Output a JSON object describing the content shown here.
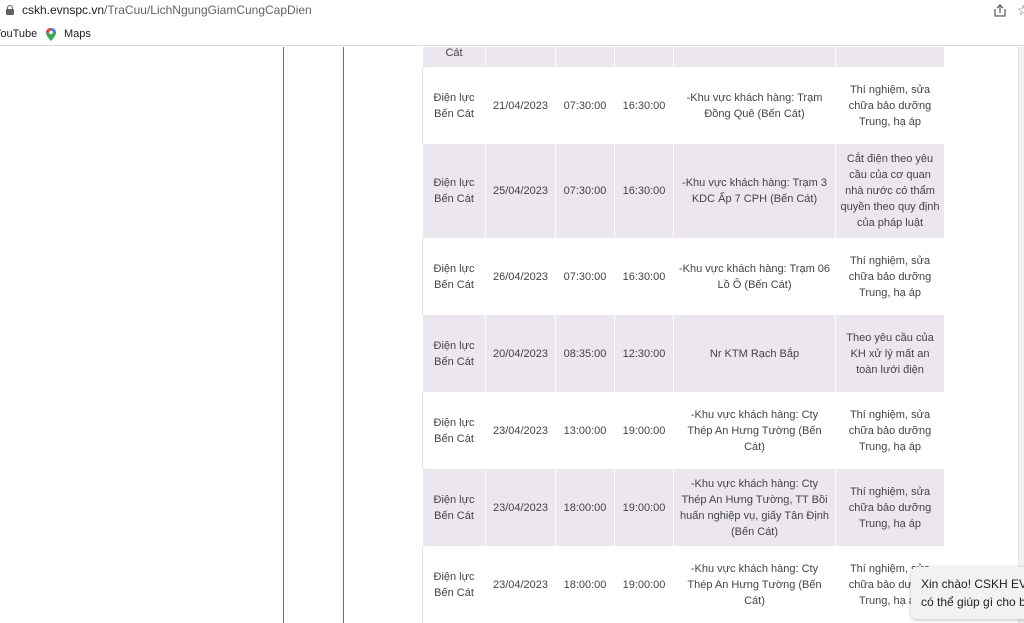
{
  "browser": {
    "url_host": "cskh.evnspc.vn",
    "url_path": "/TraCuu/LichNgungGiamCungCapDien",
    "bookmarks": [
      "YouTube",
      "Maps"
    ]
  },
  "table": {
    "top_partial_cell": "Cát",
    "rows": [
      {
        "unit": "Điện lực Bến Cát",
        "date": "21/04/2023",
        "start": "07:30:00",
        "end": "16:30:00",
        "area": "-Khu vực khách hàng: Trạm Đồng Quê (Bến Cát)",
        "reason": "Thí nghiệm, sửa chữa bảo dưỡng Trung, hạ áp"
      },
      {
        "unit": "Điện lực Bến Cát",
        "date": "25/04/2023",
        "start": "07:30:00",
        "end": "16:30:00",
        "area": "-Khu vực khách hàng: Trạm 3 KDC Ấp 7 CPH (Bến Cát)",
        "reason": "Cắt điện theo yêu cầu của cơ quan nhà nước có thẩm quyền theo quy định của pháp luật"
      },
      {
        "unit": "Điện lực Bến Cát",
        "date": "26/04/2023",
        "start": "07:30:00",
        "end": "16:30:00",
        "area": "-Khu vực khách hàng: Trạm 06 Lồ Ô (Bến Cát)",
        "reason": "Thí nghiệm, sửa chữa bảo dưỡng Trung, hạ áp"
      },
      {
        "unit": "Điện lực Bến Cát",
        "date": "20/04/2023",
        "start": "08:35:00",
        "end": "12:30:00",
        "area": "Nr KTM Rạch Bắp",
        "reason": "Theo yêu cầu của KH xử lý mất an toàn lưới điện"
      },
      {
        "unit": "Điện lực Bến Cát",
        "date": "23/04/2023",
        "start": "13:00:00",
        "end": "19:00:00",
        "area": "-Khu vực khách hàng: Cty Thép An Hưng Tường (Bến Cát)",
        "reason": "Thí nghiệm, sửa chữa bảo dưỡng Trung, hạ áp"
      },
      {
        "unit": "Điện lực Bến Cát",
        "date": "23/04/2023",
        "start": "18:00:00",
        "end": "19:00:00",
        "area": "-Khu vực khách hàng: Cty Thép An Hưng Tường, TT Bồi huấn nghiệp vụ, giấy Tân Định (Bến Cát)",
        "reason": "Thí nghiệm, sửa chữa bảo dưỡng Trung, hạ áp"
      },
      {
        "unit": "Điện lực Bến Cát",
        "date": "23/04/2023",
        "start": "18:00:00",
        "end": "19:00:00",
        "area": "-Khu vực khách hàng: Cty Thép An Hưng Tường (Bến Cát)",
        "reason": "Thí nghiệm, sửa chữa bảo dưỡng Trung, hạ áp"
      }
    ]
  },
  "chat": {
    "line1": "Xin chào! CSKH EVN",
    "line2": "có thể giúp gì cho bạn"
  },
  "colors": {
    "row_shade": "#ece7ef",
    "frame_line": "#8a5a9a"
  }
}
